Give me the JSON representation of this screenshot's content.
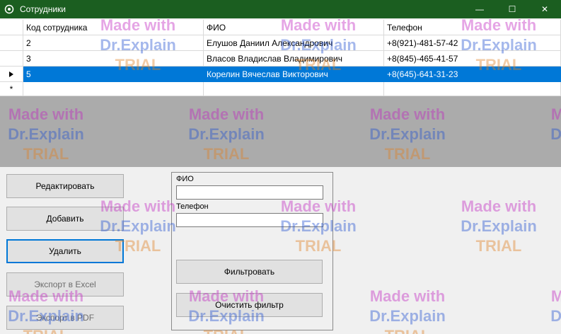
{
  "window": {
    "title": "Сотрудники",
    "icon": "gear-icon",
    "controls": {
      "minimize": "—",
      "maximize": "☐",
      "close": "✕"
    },
    "titlebar_color": "#1b5e20"
  },
  "grid": {
    "columns": [
      "Код сотрудника",
      "ФИО",
      "Телефон"
    ],
    "rows": [
      {
        "id": "2",
        "fio": "Елушов Даниил Александрович",
        "phone": "+8(921)-481-57-42"
      },
      {
        "id": "3",
        "fio": "Власов Владислав Владимирович",
        "phone": "+8(845)-465-41-57"
      },
      {
        "id": "5",
        "fio": "Корелин Вячеслав Викторович",
        "phone": "+8(645)-641-31-23"
      }
    ],
    "selected_row_index": 2,
    "new_row_marker": "*",
    "selected_color": "#0078d7"
  },
  "buttons": {
    "edit": "Редактировать",
    "add": "Добавить",
    "delete": "Удалить",
    "export_excel": "Экспорт в Excel",
    "export_pdf": "Экспорт в PDF"
  },
  "filter": {
    "fio_label": "ФИО",
    "fio_value": "",
    "phone_label": "Телефон",
    "phone_value": "",
    "filter_button": "Фильтровать",
    "clear_button": "Очистить фильтр"
  },
  "watermark": {
    "line1": "Made with",
    "line2": "Dr.Explain",
    "line3": "TRIAL"
  }
}
